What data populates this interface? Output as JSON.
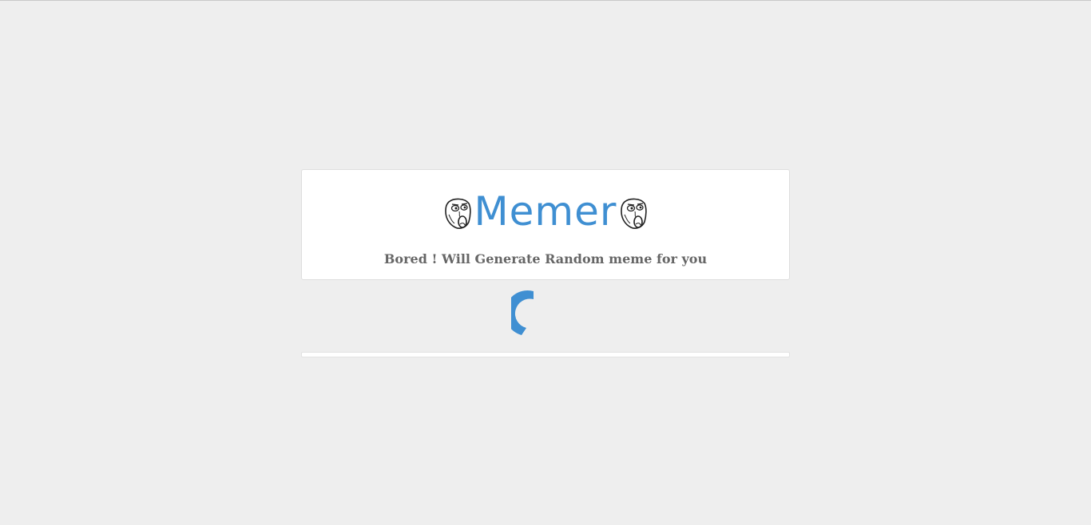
{
  "header": {
    "title": "Memer",
    "tagline": "Bored ! Will Generate Random meme for you",
    "left_icon": "rage-face-icon",
    "right_icon": "rage-face-icon"
  },
  "loader": {
    "icon": "loading-spinner-icon",
    "color": "#3f8fd2"
  },
  "colors": {
    "background": "#eeeeee",
    "accent": "#3f8fd2",
    "tagline": "#666666"
  }
}
